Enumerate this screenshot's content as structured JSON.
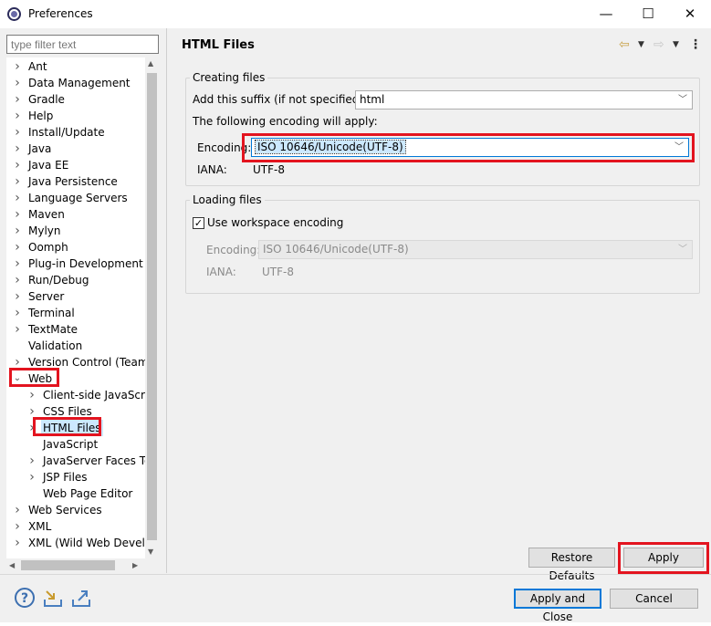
{
  "window": {
    "title": "Preferences",
    "minimize_glyph": "—",
    "maximize_glyph": "☐",
    "close_glyph": "✕"
  },
  "sidebar": {
    "filter_placeholder": "type filter text",
    "items": [
      {
        "label": "Ant",
        "expandable": true
      },
      {
        "label": "Data Management",
        "expandable": true
      },
      {
        "label": "Gradle",
        "expandable": true
      },
      {
        "label": "Help",
        "expandable": true
      },
      {
        "label": "Install/Update",
        "expandable": true
      },
      {
        "label": "Java",
        "expandable": true
      },
      {
        "label": "Java EE",
        "expandable": true
      },
      {
        "label": "Java Persistence",
        "expandable": true
      },
      {
        "label": "Language Servers",
        "expandable": true
      },
      {
        "label": "Maven",
        "expandable": true
      },
      {
        "label": "Mylyn",
        "expandable": true
      },
      {
        "label": "Oomph",
        "expandable": true
      },
      {
        "label": "Plug-in Development",
        "expandable": true
      },
      {
        "label": "Run/Debug",
        "expandable": true
      },
      {
        "label": "Server",
        "expandable": true
      },
      {
        "label": "Terminal",
        "expandable": true
      },
      {
        "label": "TextMate",
        "expandable": true
      },
      {
        "label": "Validation",
        "expandable": false
      },
      {
        "label": "Version Control (Team)",
        "expandable": true
      },
      {
        "label": "Web",
        "expandable": true,
        "expanded": true,
        "highlight": true
      },
      {
        "label": "Client-side JavaScript",
        "child": true,
        "expandable": true
      },
      {
        "label": "CSS Files",
        "child": true,
        "expandable": true
      },
      {
        "label": "HTML Files",
        "child": true,
        "expandable": true,
        "selected": true,
        "highlight": true
      },
      {
        "label": "JavaScript",
        "child": true,
        "expandable": false
      },
      {
        "label": "JavaServer Faces Tools",
        "child": true,
        "expandable": true
      },
      {
        "label": "JSP Files",
        "child": true,
        "expandable": true
      },
      {
        "label": "Web Page Editor",
        "child": true,
        "expandable": false
      },
      {
        "label": "Web Services",
        "expandable": true
      },
      {
        "label": "XML",
        "expandable": true
      },
      {
        "label": "XML (Wild Web Developer)",
        "expandable": true
      }
    ]
  },
  "page": {
    "title": "HTML Files",
    "creating": {
      "group_title": "Creating files",
      "suffix_label": "Add this suffix (if not specified):",
      "suffix_value": "html",
      "encoding_note": "The following encoding will apply:",
      "encoding_label": "Encoding:",
      "encoding_value": "ISO 10646/Unicode(UTF-8)",
      "iana_label": "IANA:",
      "iana_value": "UTF-8"
    },
    "loading": {
      "group_title": "Loading files",
      "use_workspace_label": "Use workspace encoding",
      "use_workspace_checked": true,
      "encoding_label": "Encoding:",
      "encoding_value": "ISO 10646/Unicode(UTF-8)",
      "iana_label": "IANA:",
      "iana_value": "UTF-8"
    },
    "restore_defaults_label": "Restore Defaults",
    "apply_label": "Apply"
  },
  "footer": {
    "apply_close_label": "Apply and Close",
    "cancel_label": "Cancel",
    "icons": [
      "help-icon",
      "import-icon",
      "export-icon"
    ]
  },
  "colors": {
    "highlight_red": "#e3141f",
    "selection_bg": "#cce8ff",
    "accent_blue": "#0078d7"
  }
}
